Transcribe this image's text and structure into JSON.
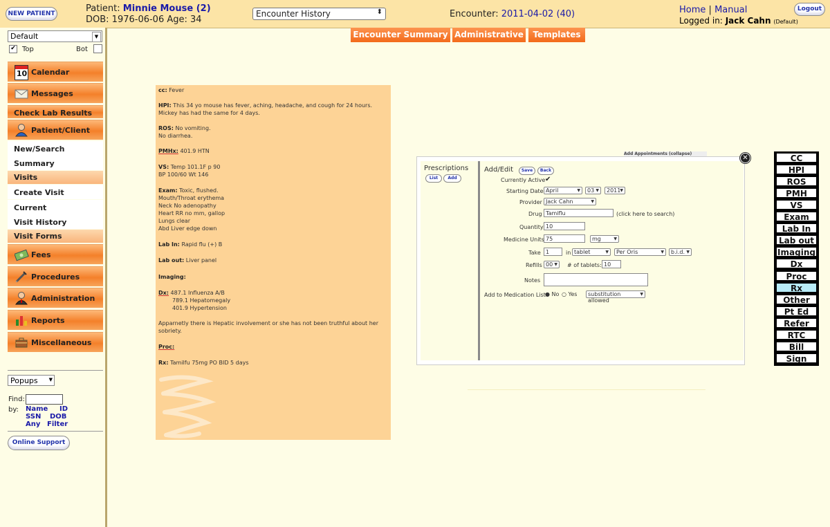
{
  "header": {
    "new_patient_label": "NEW PATIENT",
    "patient_label": "Patient:",
    "patient_name": "Minnie Mouse (2)",
    "dob_line": "DOB: 1976-06-06 Age: 34",
    "history_select": "Encounter History",
    "encounter_label": "Encounter:",
    "encounter_value": "2011-04-02 (40)",
    "home_link": "Home",
    "separator": "|",
    "manual_link": "Manual",
    "logged_in_label": "Logged in:",
    "user_name": "Jack Cahn",
    "user_group": "(Default)",
    "logout_label": "Logout"
  },
  "sidebar": {
    "facility_select": "Default",
    "top_label": "Top",
    "bot_label": "Bot",
    "top_checked": true,
    "bot_checked": false,
    "calendar_day": "10",
    "items": {
      "calendar": "Calendar",
      "messages": "Messages",
      "check_lab": "Check Lab Results",
      "patient_client": "Patient/Client",
      "new_search": "New/Search",
      "summary": "Summary",
      "visits": "Visits",
      "create_visit": "Create Visit",
      "current": "Current",
      "visit_history": "Visit History",
      "visit_forms": "Visit Forms",
      "fees": "Fees",
      "procedures": "Procedures",
      "administration": "Administration",
      "reports": "Reports",
      "miscellaneous": "Miscellaneous"
    },
    "popups_select": "Popups",
    "find_label": "Find:",
    "by_label": "by:",
    "find_links": [
      "Name",
      "ID",
      "SSN",
      "DOB",
      "Any",
      "Filter"
    ],
    "online_support": "Online Support"
  },
  "tabs": [
    "Encounter Summary",
    "Administrative",
    "Templates"
  ],
  "note": {
    "cc_label": "cc:",
    "cc": "Fever",
    "hpi_label": "HPI:",
    "hpi1": "This 34 yo mouse has fever, aching, headache, and cough for 24 hours.",
    "hpi2": "Mickey has had the same for 4 days.",
    "ros_label": "ROS:",
    "ros1": "No vomiting.",
    "ros2": "No diarrhea.",
    "pmhx_label": "PMHx:",
    "pmhx": "401.9  HTN",
    "vs_label": "VS:",
    "vs1": "Temp 101.1F    p  90",
    "vs2": "BP 100/60  Wt 146",
    "exam_label": "Exam:",
    "exam1": "Toxic,  flushed.",
    "exam2": "Mouth/Throat  erythema",
    "exam3": "Neck No adenopathy",
    "exam4": "Heart  RR no mm, gallop",
    "exam5": "Lungs clear",
    "exam6": "Abd  Liver edge down",
    "labin_label": "Lab In:",
    "labin": "Rapid flu  (+)  B",
    "labout_label": "Lab out:",
    "labout": "Liver panel",
    "imaging_label": "Imaging:",
    "dx_label": "Dx:",
    "dx1": "487.1 Influenza A/B",
    "dx2": "789.1 Hepatomegaly",
    "dx3": "401.9 Hypertension",
    "comment1": "Apparnetly there is Hepatic involvement or she has not been truthful about her",
    "comment2": "sobriety.",
    "proc_label": "Proc:",
    "rx_label": "Rx:",
    "rx": "Tamilfu 75mg PO BID 5 days"
  },
  "rx_panel": {
    "behind_text": "Add  Appointments (collapse)",
    "prescriptions_title": "Prescriptions",
    "list_btn": "List",
    "add_btn": "Add",
    "add_edit_title": "Add/Edit",
    "save_btn": "Save",
    "back_btn": "Back",
    "currently_active_label": "Currently Active",
    "currently_active": true,
    "starting_date_label": "Starting Date",
    "month": "April",
    "day": "03",
    "year": "2011",
    "provider_label": "Provider",
    "provider": "Jack Cahn",
    "drug_label": "Drug",
    "drug": "Tamiflu",
    "drug_hint": "(click here to search)",
    "quantity_label": "Quantity",
    "quantity": "10",
    "medicine_units_label": "Medicine Units",
    "medicine_units": "75",
    "unit": "mg",
    "take_label": "Take",
    "take": "1",
    "in_label": "in",
    "form": "tablet",
    "route": "Per Oris",
    "frequency": "b.i.d.",
    "refills_label": "Refills",
    "refills": "00",
    "tablets_label": "# of tablets:",
    "tablets": "10",
    "notes_label": "Notes",
    "add_to_list_label": "Add to Medication List",
    "no_label": "No",
    "yes_label": "Yes",
    "substitution": "substitution allowed"
  },
  "right_panel": {
    "buttons": [
      "CC",
      "HPI",
      "ROS",
      "PMH",
      "VS",
      "Exam",
      "Lab  In",
      "Lab  out",
      "Imaging",
      "Dx",
      "Proc",
      "Rx",
      "Other",
      "Pt Ed",
      "Refer",
      "RTC",
      "Bill",
      "Sign"
    ],
    "active": "Rx"
  },
  "colors": {
    "header_bg": "#fce4a6",
    "nav_orange": "#f4802a",
    "link_blue": "#1a1aa8",
    "note_bg": "#fdd396",
    "active_right": "#b8ecf8"
  }
}
